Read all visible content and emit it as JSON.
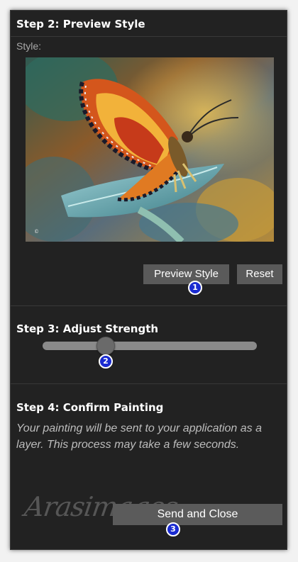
{
  "steps": {
    "preview": {
      "title": "Step 2: Preview Style",
      "style_label": "Style:"
    },
    "strength": {
      "title": "Step 3: Adjust Strength",
      "value_fraction": 0.3
    },
    "confirm": {
      "title": "Step 4: Confirm Painting",
      "description": "Your painting will be sent to your application as a layer. This process may take a few seconds."
    }
  },
  "buttons": {
    "preview_style": "Preview Style",
    "reset": "Reset",
    "send_and_close": "Send and Close"
  },
  "annotations": [
    "1",
    "2",
    "3"
  ],
  "watermark": "Arasimages",
  "colors": {
    "panel_bg": "#222222",
    "button_bg": "#5a5a5a",
    "badge_blue": "#1a2bd1",
    "slider_track": "#8a8a8a"
  }
}
